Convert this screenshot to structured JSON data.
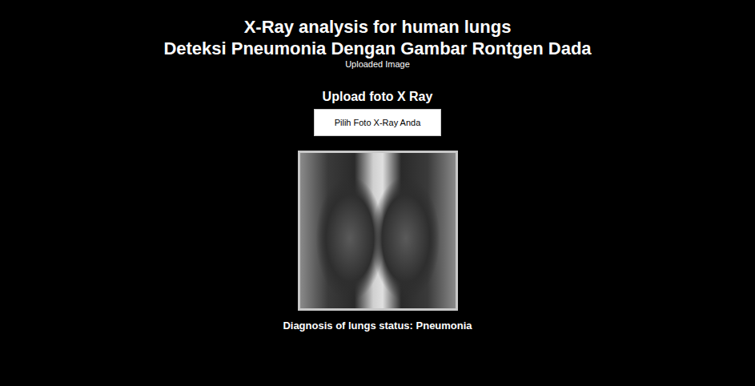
{
  "header": {
    "title": "X-Ray analysis for human lungs",
    "subtitle": "Deteksi Pneumonia Dengan Gambar Rontgen Dada",
    "caption": "Uploaded Image"
  },
  "upload": {
    "heading": "Upload foto X Ray",
    "button": "Pilih Foto X-Ray Anda"
  },
  "result": {
    "label": "Diagnosis of lungs status: Pneumonia"
  }
}
